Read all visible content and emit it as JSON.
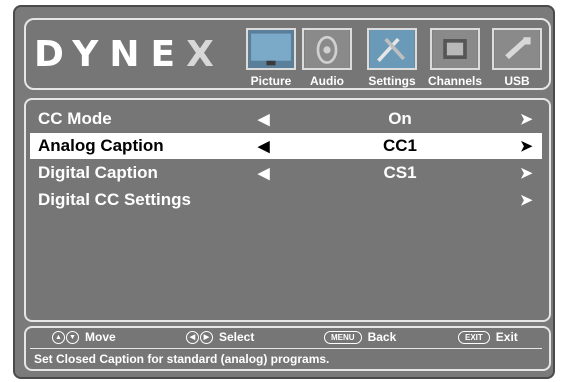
{
  "brand": {
    "logo_text": "DYNE",
    "logo_last": "X"
  },
  "tabs": [
    {
      "label": "Picture",
      "icon": "picture-icon",
      "active": false
    },
    {
      "label": "Audio",
      "icon": "audio-icon",
      "active": false
    },
    {
      "label": "Settings",
      "icon": "settings-icon",
      "active": true
    },
    {
      "label": "Channels",
      "icon": "channels-icon",
      "active": false
    },
    {
      "label": "USB",
      "icon": "usb-icon",
      "active": false
    }
  ],
  "menu": {
    "items": [
      {
        "label": "CC Mode",
        "value": "On",
        "left_arrow": "◀",
        "right_arrow": "➤",
        "selected": false
      },
      {
        "label": "Analog Caption",
        "value": "CC1",
        "left_arrow": "◀",
        "right_arrow": "➤",
        "selected": true
      },
      {
        "label": "Digital Caption",
        "value": "CS1",
        "left_arrow": "◀",
        "right_arrow": "➤",
        "selected": false
      },
      {
        "label": "Digital CC Settings",
        "value": "",
        "left_arrow": "",
        "right_arrow": "➤",
        "selected": false
      }
    ]
  },
  "footer": {
    "move_label": "Move",
    "select_label": "Select",
    "menu_key": "MENU",
    "back_label": "Back",
    "exit_key": "EXIT",
    "exit_label": "Exit",
    "description": "Set Closed Caption for standard (analog) programs."
  },
  "colors": {
    "panel": "#767676",
    "border": "#e6e6e6",
    "highlight": "#ffffff",
    "text": "#ffffff"
  }
}
